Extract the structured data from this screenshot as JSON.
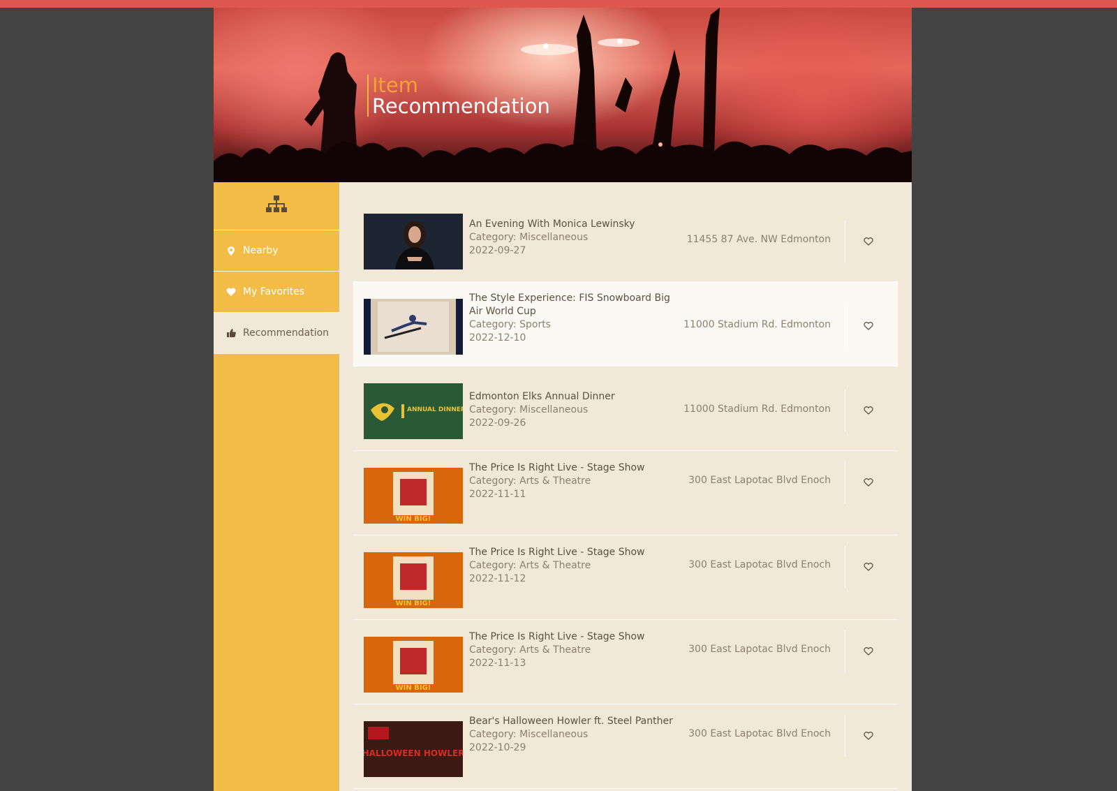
{
  "header": {
    "title_line1": "Item",
    "title_line2": "Recommendation"
  },
  "colors": {
    "accent_bar": "#e0574f",
    "sidebar": "#f2bc46",
    "main_bg": "#f1e8d8",
    "title_orange": "#f3a13a"
  },
  "sidebar": {
    "top_icon": "sitemap-icon",
    "items": [
      {
        "label": "Nearby",
        "icon": "map-marker-icon",
        "active": false
      },
      {
        "label": "My Favorites",
        "icon": "heart-icon",
        "active": false
      },
      {
        "label": "Recommendation",
        "icon": "thumbs-up-icon",
        "active": true
      }
    ]
  },
  "items": [
    {
      "name": "An Evening With Monica Lewinsky",
      "category": "Category: Miscellaneous",
      "date": "2022-09-27",
      "address": "11455 87 Ave. NW Edmonton",
      "thumb": "portrait",
      "favorite": false
    },
    {
      "name": "The Style Experience: FIS Snowboard Big Air World Cup",
      "category": "Category: Sports",
      "date": "2022-12-10",
      "address": "11000 Stadium Rd. Edmonton",
      "thumb": "snowboard",
      "favorite": false
    },
    {
      "name": "Edmonton Elks Annual Dinner",
      "category": "Category: Miscellaneous",
      "date": "2022-09-26",
      "address": "11000 Stadium Rd. Edmonton",
      "thumb": "elks",
      "thumb_text": "ANNUAL DINNER",
      "favorite": false
    },
    {
      "name": "The Price Is Right Live - Stage Show",
      "category": "Category: Arts & Theatre",
      "date": "2022-11-11",
      "address": "300 East Lapotac Blvd Enoch",
      "thumb": "price",
      "thumb_text": "WIN BIG!",
      "favorite": false
    },
    {
      "name": "The Price Is Right Live - Stage Show",
      "category": "Category: Arts & Theatre",
      "date": "2022-11-12",
      "address": "300 East Lapotac Blvd Enoch",
      "thumb": "price",
      "thumb_text": "WIN BIG!",
      "favorite": false
    },
    {
      "name": "The Price Is Right Live - Stage Show",
      "category": "Category: Arts & Theatre",
      "date": "2022-11-13",
      "address": "300 East Lapotac Blvd Enoch",
      "thumb": "price",
      "thumb_text": "WIN BIG!",
      "favorite": false
    },
    {
      "name": "Bear's Halloween Howler ft. Steel Panther",
      "category": "Category: Miscellaneous",
      "date": "2022-10-29",
      "address": "300 East Lapotac Blvd Enoch",
      "thumb": "halloween",
      "thumb_text": "HALLOWEEN HOWLER",
      "favorite": false
    }
  ]
}
